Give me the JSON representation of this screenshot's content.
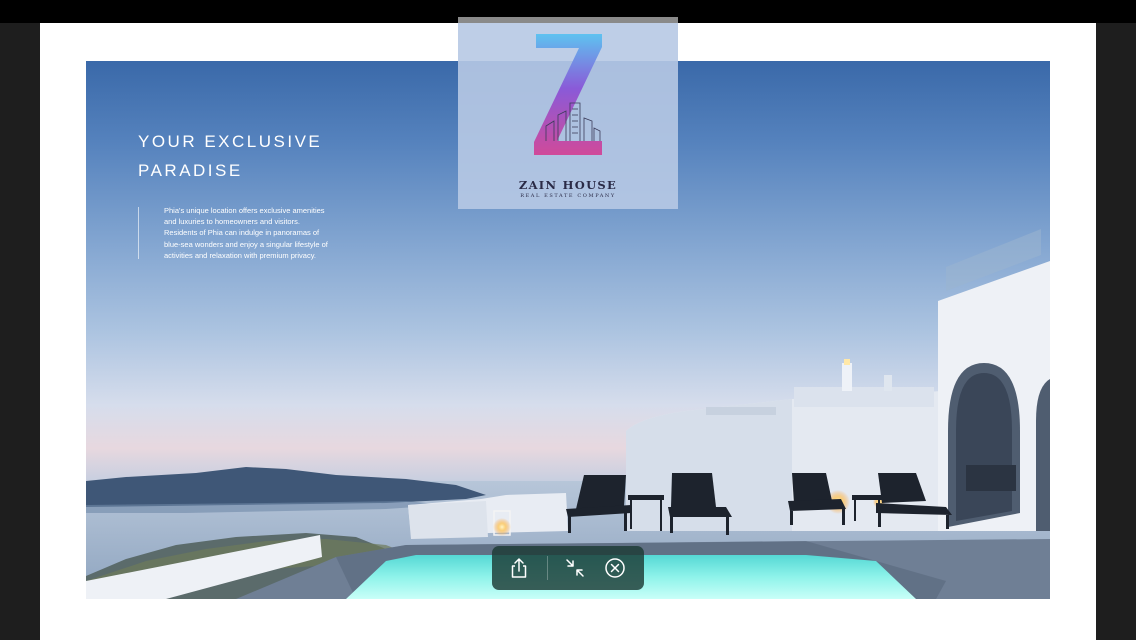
{
  "hero": {
    "title_line1": "YOUR EXCLUSIVE",
    "title_line2": "PARADISE",
    "description_lines": [
      "Phia's unique location offers exclusive amenities",
      "and luxuries to homeowners and visitors.",
      "Residents of Phia can indulge in panoramas of",
      "blue-sea wonders and enjoy a singular lifestyle of",
      "activities and relaxation with premium privacy."
    ]
  },
  "logo": {
    "name": "ZAIN HOUSE",
    "tagline": "REAL ESTATE COMPANY"
  },
  "toolbar": {
    "buttons": [
      {
        "name": "share",
        "icon": "share-icon"
      },
      {
        "name": "exit-fullscreen",
        "icon": "compress-icon"
      },
      {
        "name": "close",
        "icon": "close-icon"
      }
    ]
  },
  "colors": {
    "toolbar_bg": "#1c3a34",
    "pool": "#7ff0e6",
    "sky_top": "#3a69a9",
    "logo_gradient_top": "#5ec2f0",
    "logo_gradient_bottom": "#d04a9a"
  }
}
